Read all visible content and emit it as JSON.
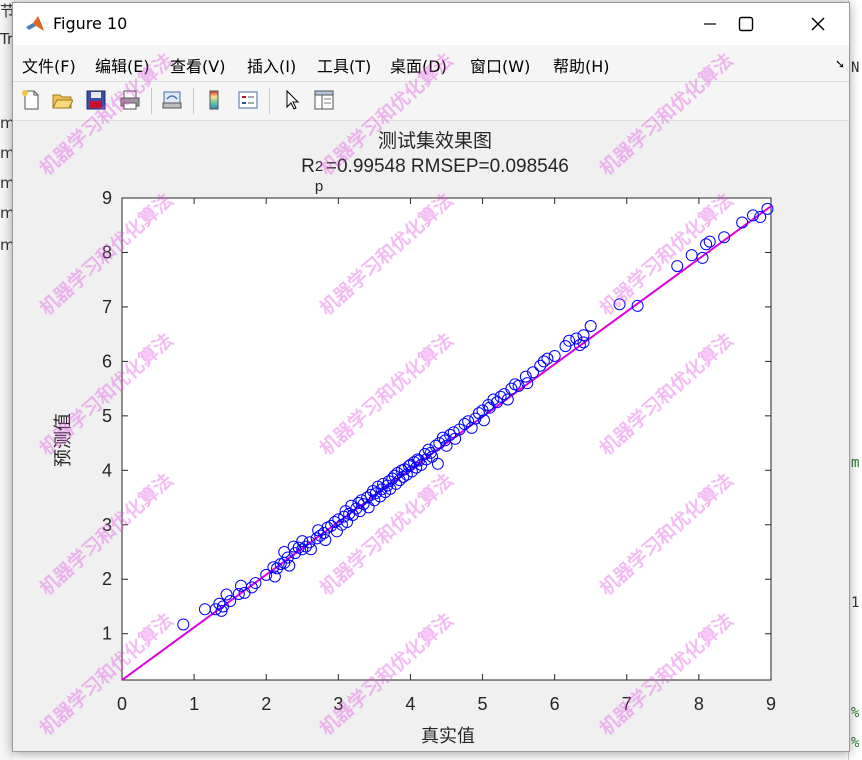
{
  "window": {
    "title": "Figure 10",
    "controls": [
      "minimize",
      "maximize",
      "close"
    ]
  },
  "menubar": [
    "文件(F)",
    "编辑(E)",
    "查看(V)",
    "插入(I)",
    "工具(T)",
    "桌面(D)",
    "窗口(W)",
    "帮助(H)"
  ],
  "toolbar": [
    "new-figure-icon",
    "open-file-icon",
    "save-icon",
    "print-icon",
    "link-plot-icon",
    "insert-colorbar-icon",
    "insert-legend-icon",
    "edit-plot-icon",
    "property-inspector-icon"
  ],
  "background": {
    "left_fragments": [
      "节",
      "Tr",
      "m",
      "m",
      "m",
      "m",
      "m"
    ],
    "right_fragments": [
      "N",
      "m",
      "1",
      "%",
      "%"
    ]
  },
  "watermark": "机器学习和优化算法",
  "chart_data": {
    "type": "scatter",
    "title": "测试集效果图",
    "subtitle": {
      "r_label": "R",
      "sup": "2",
      "sub": "p",
      "rest": "=0.99548  RMSEP=0.098546"
    },
    "xlabel": "真实值",
    "ylabel": "预测值",
    "xlim": [
      0,
      9
    ],
    "ylim": [
      0.15,
      9
    ],
    "xticks": [
      0,
      1,
      2,
      3,
      4,
      5,
      6,
      7,
      8,
      9
    ],
    "yticks": [
      1,
      2,
      3,
      4,
      5,
      6,
      7,
      8,
      9
    ],
    "grid": false,
    "colors": {
      "markers": "#0000ff",
      "fit_line": "#e000e0",
      "axes_bg": "#ffffff"
    },
    "series": [
      {
        "type": "line",
        "points": [
          [
            0.0,
            0.15
          ],
          [
            9.0,
            8.85
          ]
        ]
      },
      {
        "type": "scatter",
        "marker": "circle-open",
        "points": [
          [
            0.85,
            1.17
          ],
          [
            1.15,
            1.45
          ],
          [
            1.3,
            1.45
          ],
          [
            1.35,
            1.55
          ],
          [
            1.38,
            1.42
          ],
          [
            1.4,
            1.5
          ],
          [
            1.45,
            1.72
          ],
          [
            1.5,
            1.6
          ],
          [
            1.62,
            1.73
          ],
          [
            1.65,
            1.88
          ],
          [
            1.7,
            1.75
          ],
          [
            1.8,
            1.85
          ],
          [
            1.85,
            1.93
          ],
          [
            2.0,
            2.08
          ],
          [
            2.1,
            2.22
          ],
          [
            2.12,
            2.05
          ],
          [
            2.15,
            2.2
          ],
          [
            2.2,
            2.28
          ],
          [
            2.25,
            2.5
          ],
          [
            2.25,
            2.3
          ],
          [
            2.3,
            2.4
          ],
          [
            2.32,
            2.25
          ],
          [
            2.38,
            2.6
          ],
          [
            2.4,
            2.48
          ],
          [
            2.45,
            2.58
          ],
          [
            2.5,
            2.55
          ],
          [
            2.5,
            2.7
          ],
          [
            2.55,
            2.6
          ],
          [
            2.6,
            2.68
          ],
          [
            2.62,
            2.55
          ],
          [
            2.7,
            2.75
          ],
          [
            2.72,
            2.9
          ],
          [
            2.75,
            2.8
          ],
          [
            2.8,
            2.85
          ],
          [
            2.82,
            2.72
          ],
          [
            2.85,
            2.95
          ],
          [
            2.9,
            2.98
          ],
          [
            2.95,
            3.05
          ],
          [
            2.98,
            2.88
          ],
          [
            3.0,
            3.1
          ],
          [
            3.05,
            3.0
          ],
          [
            3.08,
            3.15
          ],
          [
            3.1,
            3.25
          ],
          [
            3.12,
            3.05
          ],
          [
            3.15,
            3.2
          ],
          [
            3.18,
            3.35
          ],
          [
            3.2,
            3.18
          ],
          [
            3.25,
            3.3
          ],
          [
            3.28,
            3.4
          ],
          [
            3.3,
            3.25
          ],
          [
            3.32,
            3.45
          ],
          [
            3.35,
            3.38
          ],
          [
            3.4,
            3.5
          ],
          [
            3.42,
            3.32
          ],
          [
            3.45,
            3.55
          ],
          [
            3.48,
            3.62
          ],
          [
            3.5,
            3.45
          ],
          [
            3.52,
            3.58
          ],
          [
            3.55,
            3.7
          ],
          [
            3.58,
            3.52
          ],
          [
            3.6,
            3.65
          ],
          [
            3.62,
            3.75
          ],
          [
            3.65,
            3.6
          ],
          [
            3.68,
            3.72
          ],
          [
            3.7,
            3.8
          ],
          [
            3.72,
            3.66
          ],
          [
            3.75,
            3.85
          ],
          [
            3.78,
            3.9
          ],
          [
            3.8,
            3.75
          ],
          [
            3.82,
            3.95
          ],
          [
            3.85,
            3.82
          ],
          [
            3.88,
            4.0
          ],
          [
            3.9,
            3.88
          ],
          [
            3.92,
            4.02
          ],
          [
            3.95,
            3.92
          ],
          [
            3.98,
            4.08
          ],
          [
            4.0,
            4.1
          ],
          [
            4.02,
            3.98
          ],
          [
            4.05,
            4.15
          ],
          [
            4.08,
            4.05
          ],
          [
            4.1,
            4.2
          ],
          [
            4.12,
            4.18
          ],
          [
            4.15,
            4.1
          ],
          [
            4.2,
            4.3
          ],
          [
            4.22,
            4.2
          ],
          [
            4.25,
            4.38
          ],
          [
            4.28,
            4.32
          ],
          [
            4.3,
            4.25
          ],
          [
            4.35,
            4.45
          ],
          [
            4.38,
            4.12
          ],
          [
            4.4,
            4.5
          ],
          [
            4.45,
            4.6
          ],
          [
            4.48,
            4.55
          ],
          [
            4.5,
            4.45
          ],
          [
            4.55,
            4.65
          ],
          [
            4.6,
            4.7
          ],
          [
            4.62,
            4.58
          ],
          [
            4.68,
            4.75
          ],
          [
            4.75,
            4.85
          ],
          [
            4.8,
            4.9
          ],
          [
            4.85,
            4.78
          ],
          [
            4.9,
            4.95
          ],
          [
            4.95,
            5.05
          ],
          [
            5.0,
            5.1
          ],
          [
            5.02,
            4.92
          ],
          [
            5.08,
            5.2
          ],
          [
            5.1,
            5.15
          ],
          [
            5.15,
            5.3
          ],
          [
            5.2,
            5.25
          ],
          [
            5.25,
            5.35
          ],
          [
            5.3,
            5.4
          ],
          [
            5.35,
            5.3
          ],
          [
            5.4,
            5.5
          ],
          [
            5.45,
            5.58
          ],
          [
            5.5,
            5.55
          ],
          [
            5.6,
            5.72
          ],
          [
            5.62,
            5.6
          ],
          [
            5.7,
            5.8
          ],
          [
            5.8,
            5.92
          ],
          [
            5.85,
            6.0
          ],
          [
            5.9,
            6.05
          ],
          [
            6.0,
            6.1
          ],
          [
            6.15,
            6.28
          ],
          [
            6.2,
            6.38
          ],
          [
            6.3,
            6.42
          ],
          [
            6.35,
            6.3
          ],
          [
            6.4,
            6.48
          ],
          [
            6.4,
            6.35
          ],
          [
            6.5,
            6.65
          ],
          [
            6.9,
            7.05
          ],
          [
            7.15,
            7.02
          ],
          [
            7.7,
            7.75
          ],
          [
            7.9,
            7.95
          ],
          [
            8.05,
            7.9
          ],
          [
            8.1,
            8.15
          ],
          [
            8.15,
            8.2
          ],
          [
            8.35,
            8.28
          ],
          [
            8.6,
            8.55
          ],
          [
            8.75,
            8.68
          ],
          [
            8.85,
            8.65
          ],
          [
            8.95,
            8.8
          ]
        ]
      }
    ],
    "legend": "none"
  }
}
